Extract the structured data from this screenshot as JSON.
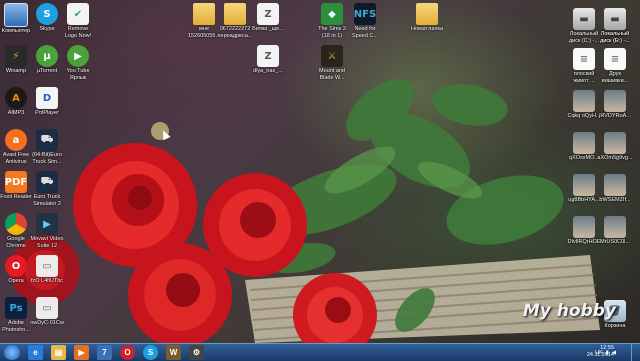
{
  "desktop": {
    "left_column": [
      {
        "label": "Компьютер",
        "icon": "computer-icon",
        "cls": "c-monitor",
        "glyph": ""
      },
      {
        "label": "Winamp",
        "icon": "winamp-icon",
        "cls": "c-winamp",
        "glyph": "⚡"
      },
      {
        "label": "AIMP3",
        "icon": "aimp-icon",
        "cls": "c-aimp",
        "glyph": "A"
      },
      {
        "label": "Avast Free\nAntivirus",
        "icon": "avast-icon",
        "cls": "c-avast",
        "glyph": "a"
      },
      {
        "label": "Foxit Reader",
        "icon": "foxit-reader-icon",
        "cls": "c-foxit",
        "glyph": "PDF"
      },
      {
        "label": "Google\nChrome",
        "icon": "chrome-icon",
        "cls": "c-chrome",
        "glyph": ""
      },
      {
        "label": "Opera",
        "icon": "opera-icon",
        "cls": "c-opera",
        "glyph": "O"
      },
      {
        "label": "Adobe\nPhotosho...",
        "icon": "photoshop-icon",
        "cls": "c-ps",
        "glyph": "Ps"
      }
    ],
    "second_column": [
      {
        "label": "Skype",
        "icon": "skype-icon",
        "cls": "c-skype",
        "glyph": "S"
      },
      {
        "label": "µTorrent",
        "icon": "utorrent-icon",
        "cls": "c-utorrent",
        "glyph": "µ"
      },
      {
        "label": "PotPlayer",
        "icon": "potplayer-icon",
        "cls": "c-pot",
        "glyph": "D"
      },
      {
        "label": "(64-Bit)Euro\nTruck Sim...",
        "icon": "euro-truck-64-icon",
        "cls": "c-truck",
        "glyph": "⛟"
      },
      {
        "label": "Euro Truck\nSimulator 2",
        "icon": "euro-truck-icon",
        "cls": "c-truck",
        "glyph": "⛟"
      },
      {
        "label": "Movavi Video\nSuite 12",
        "icon": "movavi-icon",
        "cls": "c-movavi",
        "glyph": "▶"
      },
      {
        "label": "fzO L4fiUThc",
        "icon": "image-file-icon",
        "cls": "c-file",
        "glyph": "▭"
      },
      {
        "label": "nwDyC-01Cw",
        "icon": "image-file-icon",
        "cls": "c-file",
        "glyph": "▭"
      }
    ],
    "third_column": [
      {
        "label": "Remove\nLogo Now!",
        "icon": "remove-logo-icon",
        "cls": "c-remove",
        "glyph": "✔"
      },
      {
        "label": "You Tube\nЯрлык",
        "icon": "youtube-shortcut-icon",
        "cls": "c-youtube",
        "glyph": "▶"
      }
    ],
    "top_row": [
      {
        "label": "мне\n152605055...",
        "icon": "folder-icon",
        "cls": "c-folder",
        "glyph": ""
      },
      {
        "label": "0672222272\nпереадреса...",
        "icon": "folder-icon",
        "cls": "c-folder",
        "glyph": ""
      },
      {
        "label": "Битва _ще...",
        "icon": "archive-icon",
        "cls": "c-zip",
        "glyph": "Z"
      },
      {
        "label": "The Sims 2\n(18 in 1)",
        "icon": "sims-icon",
        "cls": "c-sims",
        "glyph": "◆"
      },
      {
        "label": "Need for\nSpeed C...",
        "icon": "nfs-icon",
        "cls": "c-nfs",
        "glyph": "NFS"
      },
      {
        "label": "Новая папка",
        "icon": "folder-icon",
        "cls": "c-folder",
        "glyph": ""
      }
    ],
    "middle_row": [
      {
        "label": "dlya_nas_...",
        "icon": "archive-icon",
        "cls": "c-zip",
        "glyph": "Z"
      },
      {
        "label": "Mount and\nBlade W...",
        "icon": "mount-blade-icon",
        "cls": "c-mount",
        "glyph": "⚔"
      }
    ],
    "right_a": [
      {
        "label": "Локальный\nдиск (C:) -...",
        "icon": "drive-icon",
        "cls": "c-drive",
        "glyph": "▬"
      },
      {
        "label": "плоский\nживот ...",
        "icon": "document-icon",
        "cls": "c-doc",
        "glyph": "≡"
      },
      {
        "label": "Cqkq oQyH...",
        "icon": "photo-icon",
        "cls": "c-photo",
        "glyph": ""
      },
      {
        "label": "qXOsxMO...",
        "icon": "photo-icon",
        "cls": "c-photo",
        "glyph": ""
      },
      {
        "label": "ug8BbHYA...",
        "icon": "photo-icon",
        "cls": "c-photo",
        "glyph": ""
      },
      {
        "label": "DIvIlRQrHOE",
        "icon": "photo-icon",
        "cls": "c-photo",
        "glyph": ""
      }
    ],
    "right_b": [
      {
        "label": "Локальный\nдиск (D:) -...",
        "icon": "drive-icon",
        "cls": "c-drive",
        "glyph": "▬"
      },
      {
        "label": "Друк\nвишивки...",
        "icon": "document-icon",
        "cls": "c-doc",
        "glyph": "≡"
      }
    ],
    "right_c": [
      {
        "label": "Локальный\nдиск (E:) -...",
        "icon": "drive-icon",
        "cls": "c-drive",
        "glyph": "▬"
      },
      {
        "label": "jRVDYRuA...",
        "icon": "photo-icon",
        "cls": "c-photo",
        "glyph": ""
      },
      {
        "label": "aXOm5g9vg...",
        "icon": "photo-icon",
        "cls": "c-photo",
        "glyph": ""
      },
      {
        "label": "bWSEMZIf...",
        "icon": "photo-icon",
        "cls": "c-photo",
        "glyph": ""
      },
      {
        "label": "MrUS0C0l...",
        "icon": "photo-icon",
        "cls": "c-photo",
        "glyph": ""
      },
      {
        "label": "Корзина",
        "icon": "recycle-bin-icon",
        "cls": "c-bin",
        "glyph": "🗑"
      }
    ],
    "watermark": "My hobby"
  },
  "taskbar": {
    "pinned": [
      {
        "icon": "ie-icon",
        "cls": "tb-ie",
        "glyph": "e"
      },
      {
        "icon": "file-explorer-icon",
        "cls": "tb-explorer",
        "glyph": "▤"
      },
      {
        "icon": "media-player-icon",
        "cls": "tb-media",
        "glyph": "▶"
      },
      {
        "icon": "windows-7-icon",
        "cls": "tb-w7",
        "glyph": "7"
      },
      {
        "icon": "opera-icon",
        "cls": "tb-opera",
        "glyph": "O"
      },
      {
        "icon": "skype-icon",
        "cls": "tb-skype",
        "glyph": "S"
      },
      {
        "icon": "game-icon",
        "cls": "tb-wow",
        "glyph": "W"
      },
      {
        "icon": "app-icon",
        "cls": "tb-game",
        "glyph": "⚙"
      }
    ],
    "tray": {
      "lang": "UK",
      "time": "12:55",
      "date": "24.11.2014"
    }
  }
}
